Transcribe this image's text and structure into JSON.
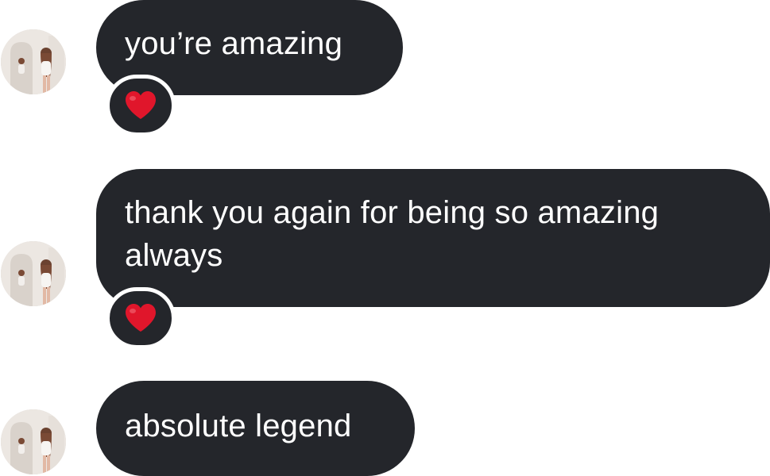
{
  "messages": [
    {
      "text": "you’re amazing",
      "reaction": "heart-emoji"
    },
    {
      "text": "thank you again for being so amazing always",
      "reaction": "heart-emoji"
    },
    {
      "text": "absolute legend",
      "reaction": null
    }
  ],
  "colors": {
    "bubble": "#24262b",
    "text": "#ffffff",
    "heart": "#e0162b",
    "background": "#ffffff"
  },
  "icons": {
    "avatar": "profile-photo-avatar",
    "reaction": "red-heart-emoji"
  }
}
